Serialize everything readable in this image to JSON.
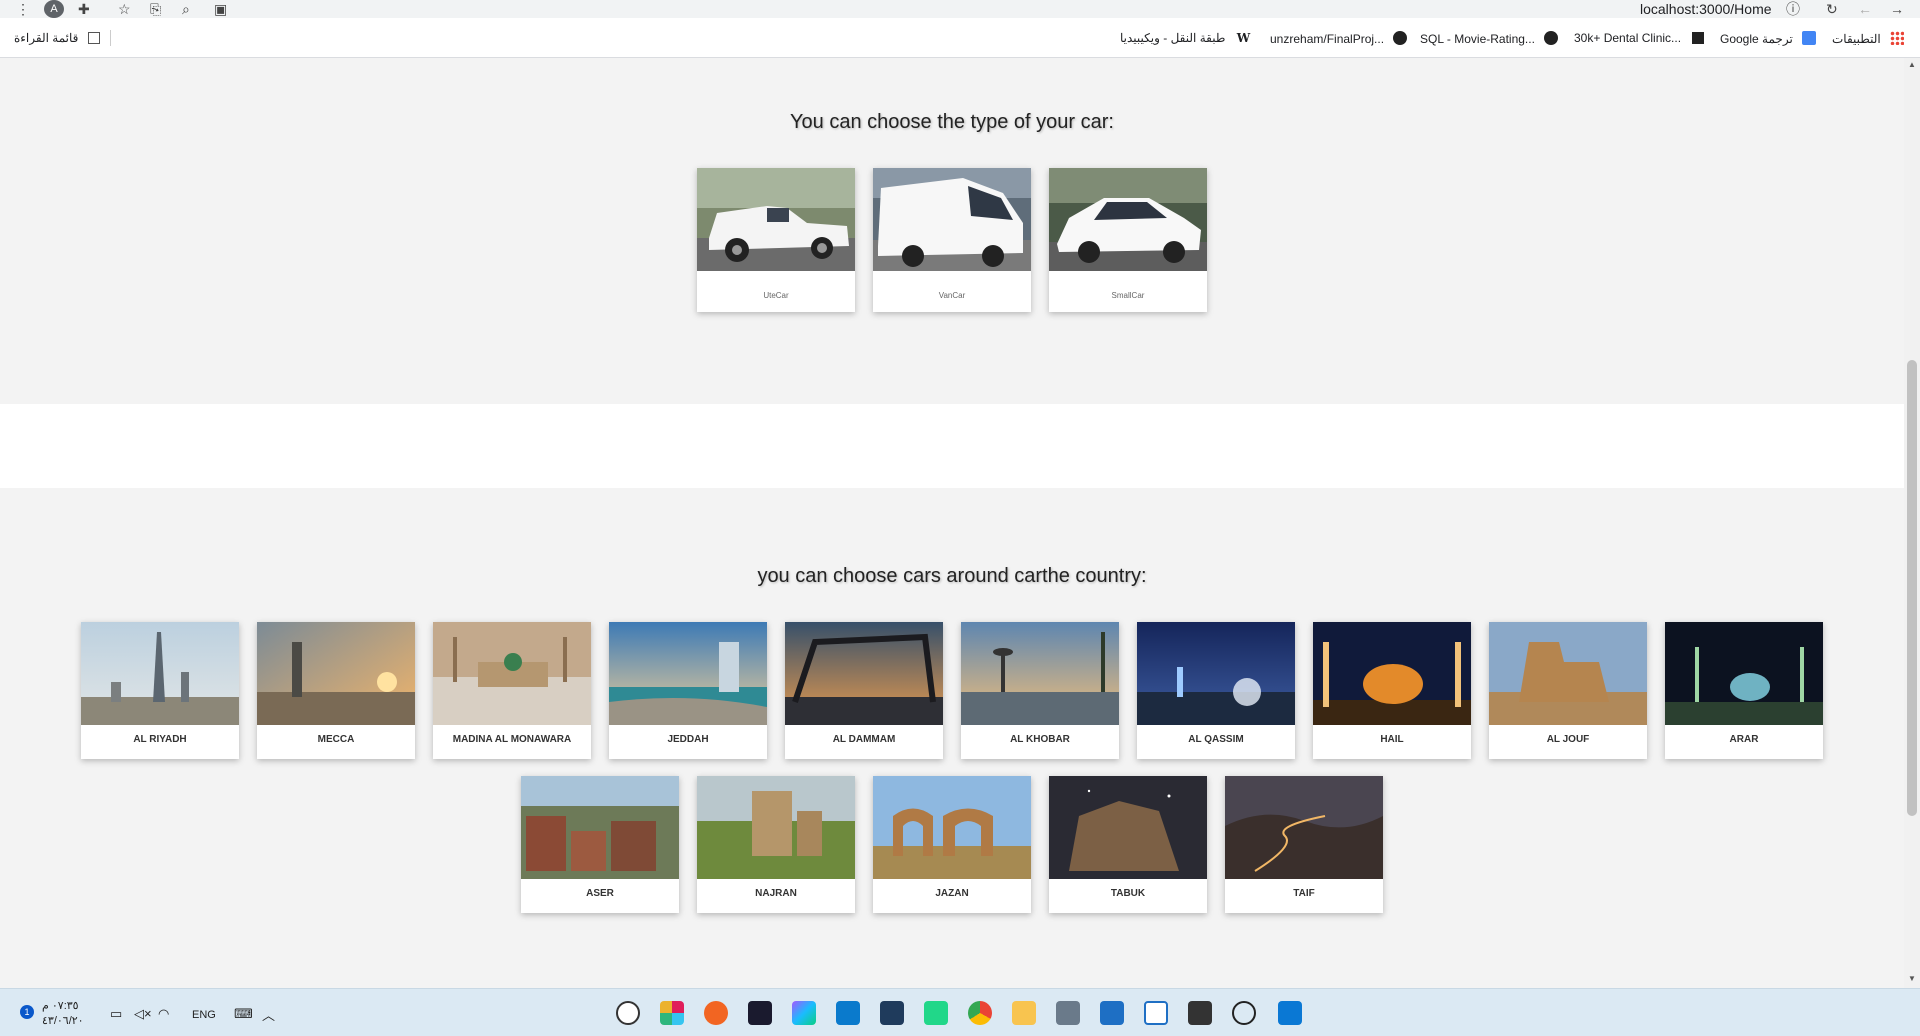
{
  "browser": {
    "url": "localhost:3000/Home",
    "profile_initial": "A",
    "bookmarks": [
      {
        "label": "التطبيقات",
        "icon": "apps-grid-icon"
      },
      {
        "label": "Google ترجمة",
        "icon": "google-translate-icon"
      },
      {
        "label": "30k+ Dental Clinic...",
        "icon": "bookmark-icon"
      },
      {
        "label": "SQL - Movie-Rating...",
        "icon": "github-icon"
      },
      {
        "label": "unzreham/FinalProj...",
        "icon": "github-icon"
      },
      {
        "label": "طبقة النقل - ويكيبيديا",
        "icon": "wikipedia-icon"
      }
    ],
    "reading_list": "قائمة القراءة"
  },
  "cars_section": {
    "title": "You can choose the type of your car:",
    "cars": [
      {
        "label": "UteCar"
      },
      {
        "label": "VanCar"
      },
      {
        "label": "SmallCar"
      }
    ]
  },
  "cities_section": {
    "title": "you can choose cars around carthe country:",
    "cities": [
      {
        "label": "AL RIYADH"
      },
      {
        "label": "MECCA"
      },
      {
        "label": "MADINA AL MONAWARA"
      },
      {
        "label": "JEDDAH"
      },
      {
        "label": "AL DAMMAM"
      },
      {
        "label": "AL KHOBAR"
      },
      {
        "label": "AL QASSIM"
      },
      {
        "label": "HAIL"
      },
      {
        "label": "AL JOUF"
      },
      {
        "label": "ARAR"
      },
      {
        "label": "ASER"
      },
      {
        "label": "NAJRAN"
      },
      {
        "label": "JAZAN"
      },
      {
        "label": "TABUK"
      },
      {
        "label": "TAIF"
      }
    ]
  },
  "taskbar": {
    "time": "٠٧:٣٥ م",
    "date": "٤٣/٠٦/٢٠",
    "language": "ENG",
    "notification_count": "1"
  }
}
